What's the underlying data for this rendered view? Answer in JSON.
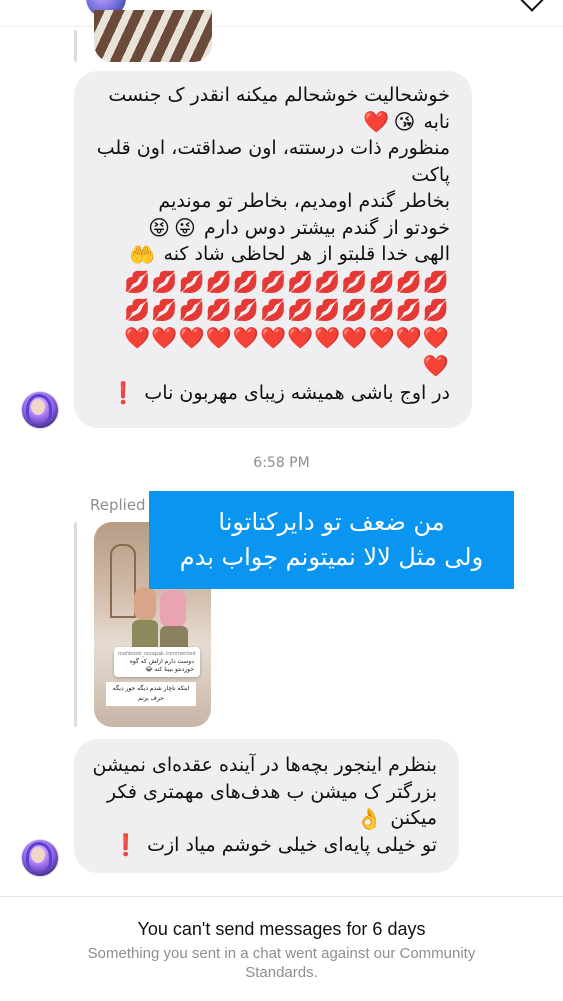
{
  "time_separator": "6:58 PM",
  "reply": {
    "replied_label": "Replied",
    "overlay_line1": "من ضعف تو دایرکتاتونا",
    "overlay_line2": "ولی مثل لالا نمیتونم جواب بدم",
    "preview_comment_user": "mahboob_rezapak commented",
    "preview_comment_line1": "دوست دارم ازلش که گوه",
    "preview_comment_line2": "خوردنتو ببینا کنه 😂",
    "preview_caption_line1": "اینکه ناچار شدم دیگه جور دیگه",
    "preview_caption_line2": "حرف بزنم"
  },
  "messages": [
    {
      "lines": [
        "خوشحالیت خوشحالم میکنه انقدر ک جنست",
        "نابه",
        "منظورم ذات درستته، اون صداقتت، اون قلب",
        "پاکت",
        "بخاطر گندم اومدیم، بخاطر تو موندیم",
        "خودتو از گندم بیشتر دوس دارم",
        "الهی خدا قلبتو از هر لحاظی شاد کنه",
        "در اوج باشی همیشه زیبای مهربون ناب"
      ],
      "emoji_kiss_face": "😘",
      "emoji_heart": "❤️",
      "emoji_wink_tongue": "😜",
      "emoji_squint_tongue": "😝",
      "emoji_raised_hands": "🤲",
      "emoji_lips_row": "💋💋💋💋💋💋💋💋💋💋💋💋",
      "emoji_hearts_row": "❤️❤️❤️❤️❤️❤️❤️❤️❤️❤️❤️❤️",
      "emoji_heart_single": "❤️",
      "emoji_exclamation": "❗️"
    },
    {
      "lines": [
        "بنظرم اینجور بچه‌ها در آینده عقده‌ای نمیشن",
        "بزرگتر ک میشن ب هدف‌های مهمتری فکر",
        "میکنن",
        "تو خیلی پایه‌ای خیلی خوشم میاد ازت"
      ],
      "emoji_ok_hand": "👌",
      "emoji_exclamation": "❗️"
    }
  ],
  "footer": {
    "restriction_title": "You can't send messages for 6 days",
    "restriction_subtitle": "Something you sent in a chat went against our Community Standards."
  },
  "colors": {
    "overlay_blue": "#0a95f0",
    "bubble_gray": "#efeff1",
    "muted_text": "#8e8e8e"
  }
}
